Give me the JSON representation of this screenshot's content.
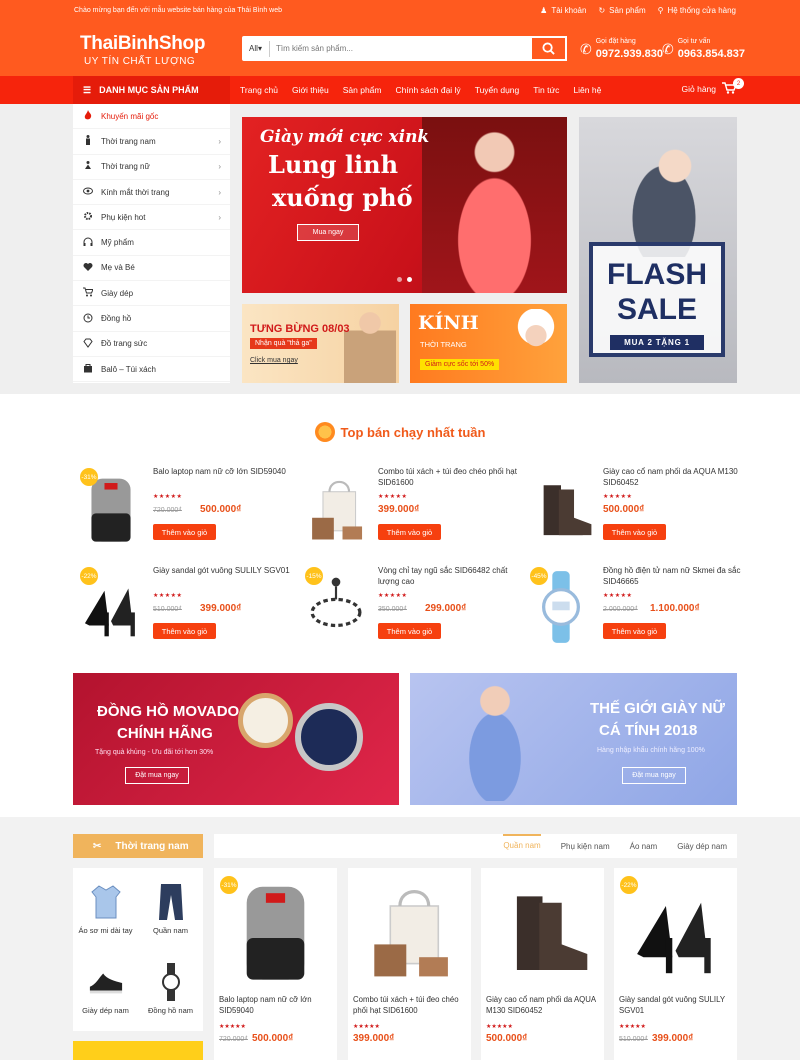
{
  "header": {
    "welcome": "Chào mừng bạn đến với mẫu website bán hàng của Thái Bình web",
    "links": [
      "Tài khoản",
      "Sản phẩm",
      "Hệ thống cửa hàng"
    ],
    "logo": "ThaiBinhShop",
    "slogan": "UY TÍN CHẤT LƯỢNG",
    "search_scope": "All",
    "search_placeholder": "Tìm kiếm sản phẩm...",
    "hotlines": [
      {
        "label": "Gọi đặt hàng",
        "number": "0972.939.830"
      },
      {
        "label": "Gọi tư vấn",
        "number": "0963.854.837"
      }
    ]
  },
  "nav": {
    "category_button": "DANH MỤC SẢN PHẨM",
    "menu": [
      "Trang chủ",
      "Giới thiệu",
      "Sản phẩm",
      "Chính sách đại lý",
      "Tuyển dụng",
      "Tin tức",
      "Liên hệ"
    ],
    "cart_label": "Giỏ hàng",
    "cart_count": "2"
  },
  "sidebar": {
    "items": [
      {
        "label": "Khuyến mãi gốc",
        "icon": "fire-icon",
        "arrow": false
      },
      {
        "label": "Thời trang nam",
        "icon": "man-icon",
        "arrow": true
      },
      {
        "label": "Thời trang nữ",
        "icon": "woman-icon",
        "arrow": true
      },
      {
        "label": "Kính mắt thời trang",
        "icon": "eye-icon",
        "arrow": true
      },
      {
        "label": "Phụ kiện hot",
        "icon": "gear-icon",
        "arrow": true
      },
      {
        "label": "Mỹ phẩm",
        "icon": "headset-icon",
        "arrow": false
      },
      {
        "label": "Mẹ và Bé",
        "icon": "heartbeat-icon",
        "arrow": false
      },
      {
        "label": "Giày dép",
        "icon": "cart-icon",
        "arrow": false
      },
      {
        "label": "Đồng hồ",
        "icon": "clock-icon",
        "arrow": false
      },
      {
        "label": "Đồ trang sức",
        "icon": "diamond-icon",
        "arrow": false
      },
      {
        "label": "Balô – Túi xách",
        "icon": "bag-icon",
        "arrow": false
      }
    ]
  },
  "banners": {
    "main": {
      "line1": "Giày mới cực xink",
      "line2": "Lung linh",
      "line3": "xuống phố",
      "button": "Mua ngay"
    },
    "small1": {
      "title": "TƯNG BỪNG 08/03",
      "tag": "Nhận quà \"thả ga\"",
      "link": "Click mua ngay"
    },
    "small2": {
      "title": "KÍNH",
      "subtitle": "THỜI TRANG",
      "tag": "Giảm cực sốc tới 50%"
    },
    "side": {
      "line1": "FLASH",
      "line2": "SALE",
      "offer": "MUA 2 TẶNG 1"
    }
  },
  "top_sellers": {
    "title": "Top bán chạy nhất tuần",
    "add_label": "Thêm vào giỏ",
    "stars": "★★★★★",
    "products": [
      {
        "name": "Balo laptop nam nữ cỡ lớn SID59040",
        "old": "720.000₫",
        "new": "500.000₫",
        "discount": "-31%",
        "thumb": "backpack"
      },
      {
        "name": "Combo túi xách + túi đeo chéo phối hạt SID61600",
        "old": "",
        "new": "399.000₫",
        "discount": "",
        "thumb": "handbag"
      },
      {
        "name": "Giày cao cổ nam phối da AQUA M130 SID60452",
        "old": "",
        "new": "500.000₫",
        "discount": "",
        "thumb": "boot"
      },
      {
        "name": "Giày sandal gót vuông SULILY SGV01",
        "old": "510.000₫",
        "new": "399.000₫",
        "discount": "-22%",
        "thumb": "sandal"
      },
      {
        "name": "Vòng chỉ tay ngũ sắc SID66482 chất lượng cao",
        "old": "350.000₫",
        "new": "299.000₫",
        "discount": "-15%",
        "thumb": "bracelet"
      },
      {
        "name": "Đồng hồ điện tử nam nữ Skmei đa sắc SID46665",
        "old": "2.000.000₫",
        "new": "1.100.000₫",
        "discount": "-45%",
        "thumb": "watch"
      }
    ]
  },
  "promos": {
    "a": {
      "line1": "ĐỒNG HỒ MOVADO",
      "line2": "CHÍNH HÃNG",
      "line3": "Tặng quà khủng - Ưu đãi tới hơn 30%",
      "button": "Đặt mua ngay"
    },
    "b": {
      "line1": "THẾ GIỚI GIÀY NỮ",
      "line2": "CÁ TÍNH 2018",
      "line3": "Hàng nhập khẩu chính hãng 100%",
      "button": "Đặt mua ngay"
    }
  },
  "category_section": {
    "title": "Thời trang nam",
    "tabs": [
      "Quần nam",
      "Phụ kiện nam",
      "Áo nam",
      "Giày dép nam"
    ],
    "subcats": [
      "Áo sơ mi dài tay",
      "Quần nam",
      "Giày dép nam",
      "Đồng hồ nam"
    ],
    "products": [
      {
        "name": "Balo laptop nam nữ cỡ lớn SID59040",
        "old": "720.000₫",
        "new": "500.000₫",
        "discount": "-31%",
        "thumb": "backpack"
      },
      {
        "name": "Combo túi xách + túi đeo chéo phối hạt SID61600",
        "old": "",
        "new": "399.000₫",
        "discount": "",
        "thumb": "handbag"
      },
      {
        "name": "Giày cao cổ nam phối da AQUA M130 SID60452",
        "old": "",
        "new": "500.000₫",
        "discount": "",
        "thumb": "boot"
      },
      {
        "name": "Giày sandal gót vuông SULILY SGV01",
        "old": "510.000₫",
        "new": "399.000₫",
        "discount": "-22%",
        "thumb": "sandal"
      }
    ]
  },
  "colors": {
    "primary": "#ff5a1f",
    "nav": "#f6240c",
    "accent": "#f0b45c"
  }
}
